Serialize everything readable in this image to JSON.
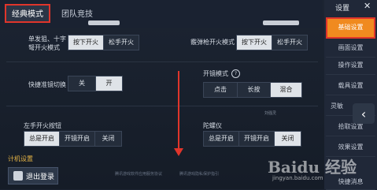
{
  "tabs": {
    "classic": "经典模式",
    "team": "团队竞技"
  },
  "settings": {
    "fire_mode": {
      "label_line1": "单发狙、十字",
      "label_line2": "弩开火模式",
      "options": [
        "按下开火",
        "松手开火"
      ],
      "selected": 0
    },
    "shotgun_fire": {
      "label": "霰弹枪开火模式",
      "options": [
        "按下开火",
        "松手开火"
      ],
      "selected": 0
    },
    "quick_scope": {
      "label": "快捷准镜切换",
      "options": [
        "关",
        "开"
      ],
      "selected": 1
    },
    "scope_mode": {
      "label": "开镜模式",
      "help": "?",
      "options": [
        "点击",
        "长按",
        "混合"
      ],
      "selected": 2
    },
    "left_fire": {
      "label": "左手开火按钮",
      "options": [
        "总是开启",
        "开镜开启",
        "关闭"
      ],
      "selected": 0
    },
    "gyroscope": {
      "label": "陀螺仪",
      "options": [
        "总是开启",
        "开镜开启",
        "关闭"
      ],
      "selected": 2
    }
  },
  "bottom": {
    "logout_label": "退出登录",
    "footnote_left": "腾讯游戏软件应用服务协议",
    "footnote_right": "腾讯游戏隐私保护指引",
    "partial_label": "计机设置"
  },
  "sidebar": {
    "title": "设置",
    "close": "✕",
    "items": [
      "基础设置",
      "画面设置",
      "操作设置",
      "载具设置",
      "灵敏",
      "拾取设置",
      "效果设置",
      "快捷消息"
    ],
    "active_index": 0,
    "back_icon": "‹"
  },
  "watermark": {
    "text": "Baidu 经验",
    "sub": "jingyan.baidu.com",
    "small": "刘强灵"
  },
  "colors": {
    "highlight": "#e0352b",
    "active_tab": "#f08a1f"
  }
}
